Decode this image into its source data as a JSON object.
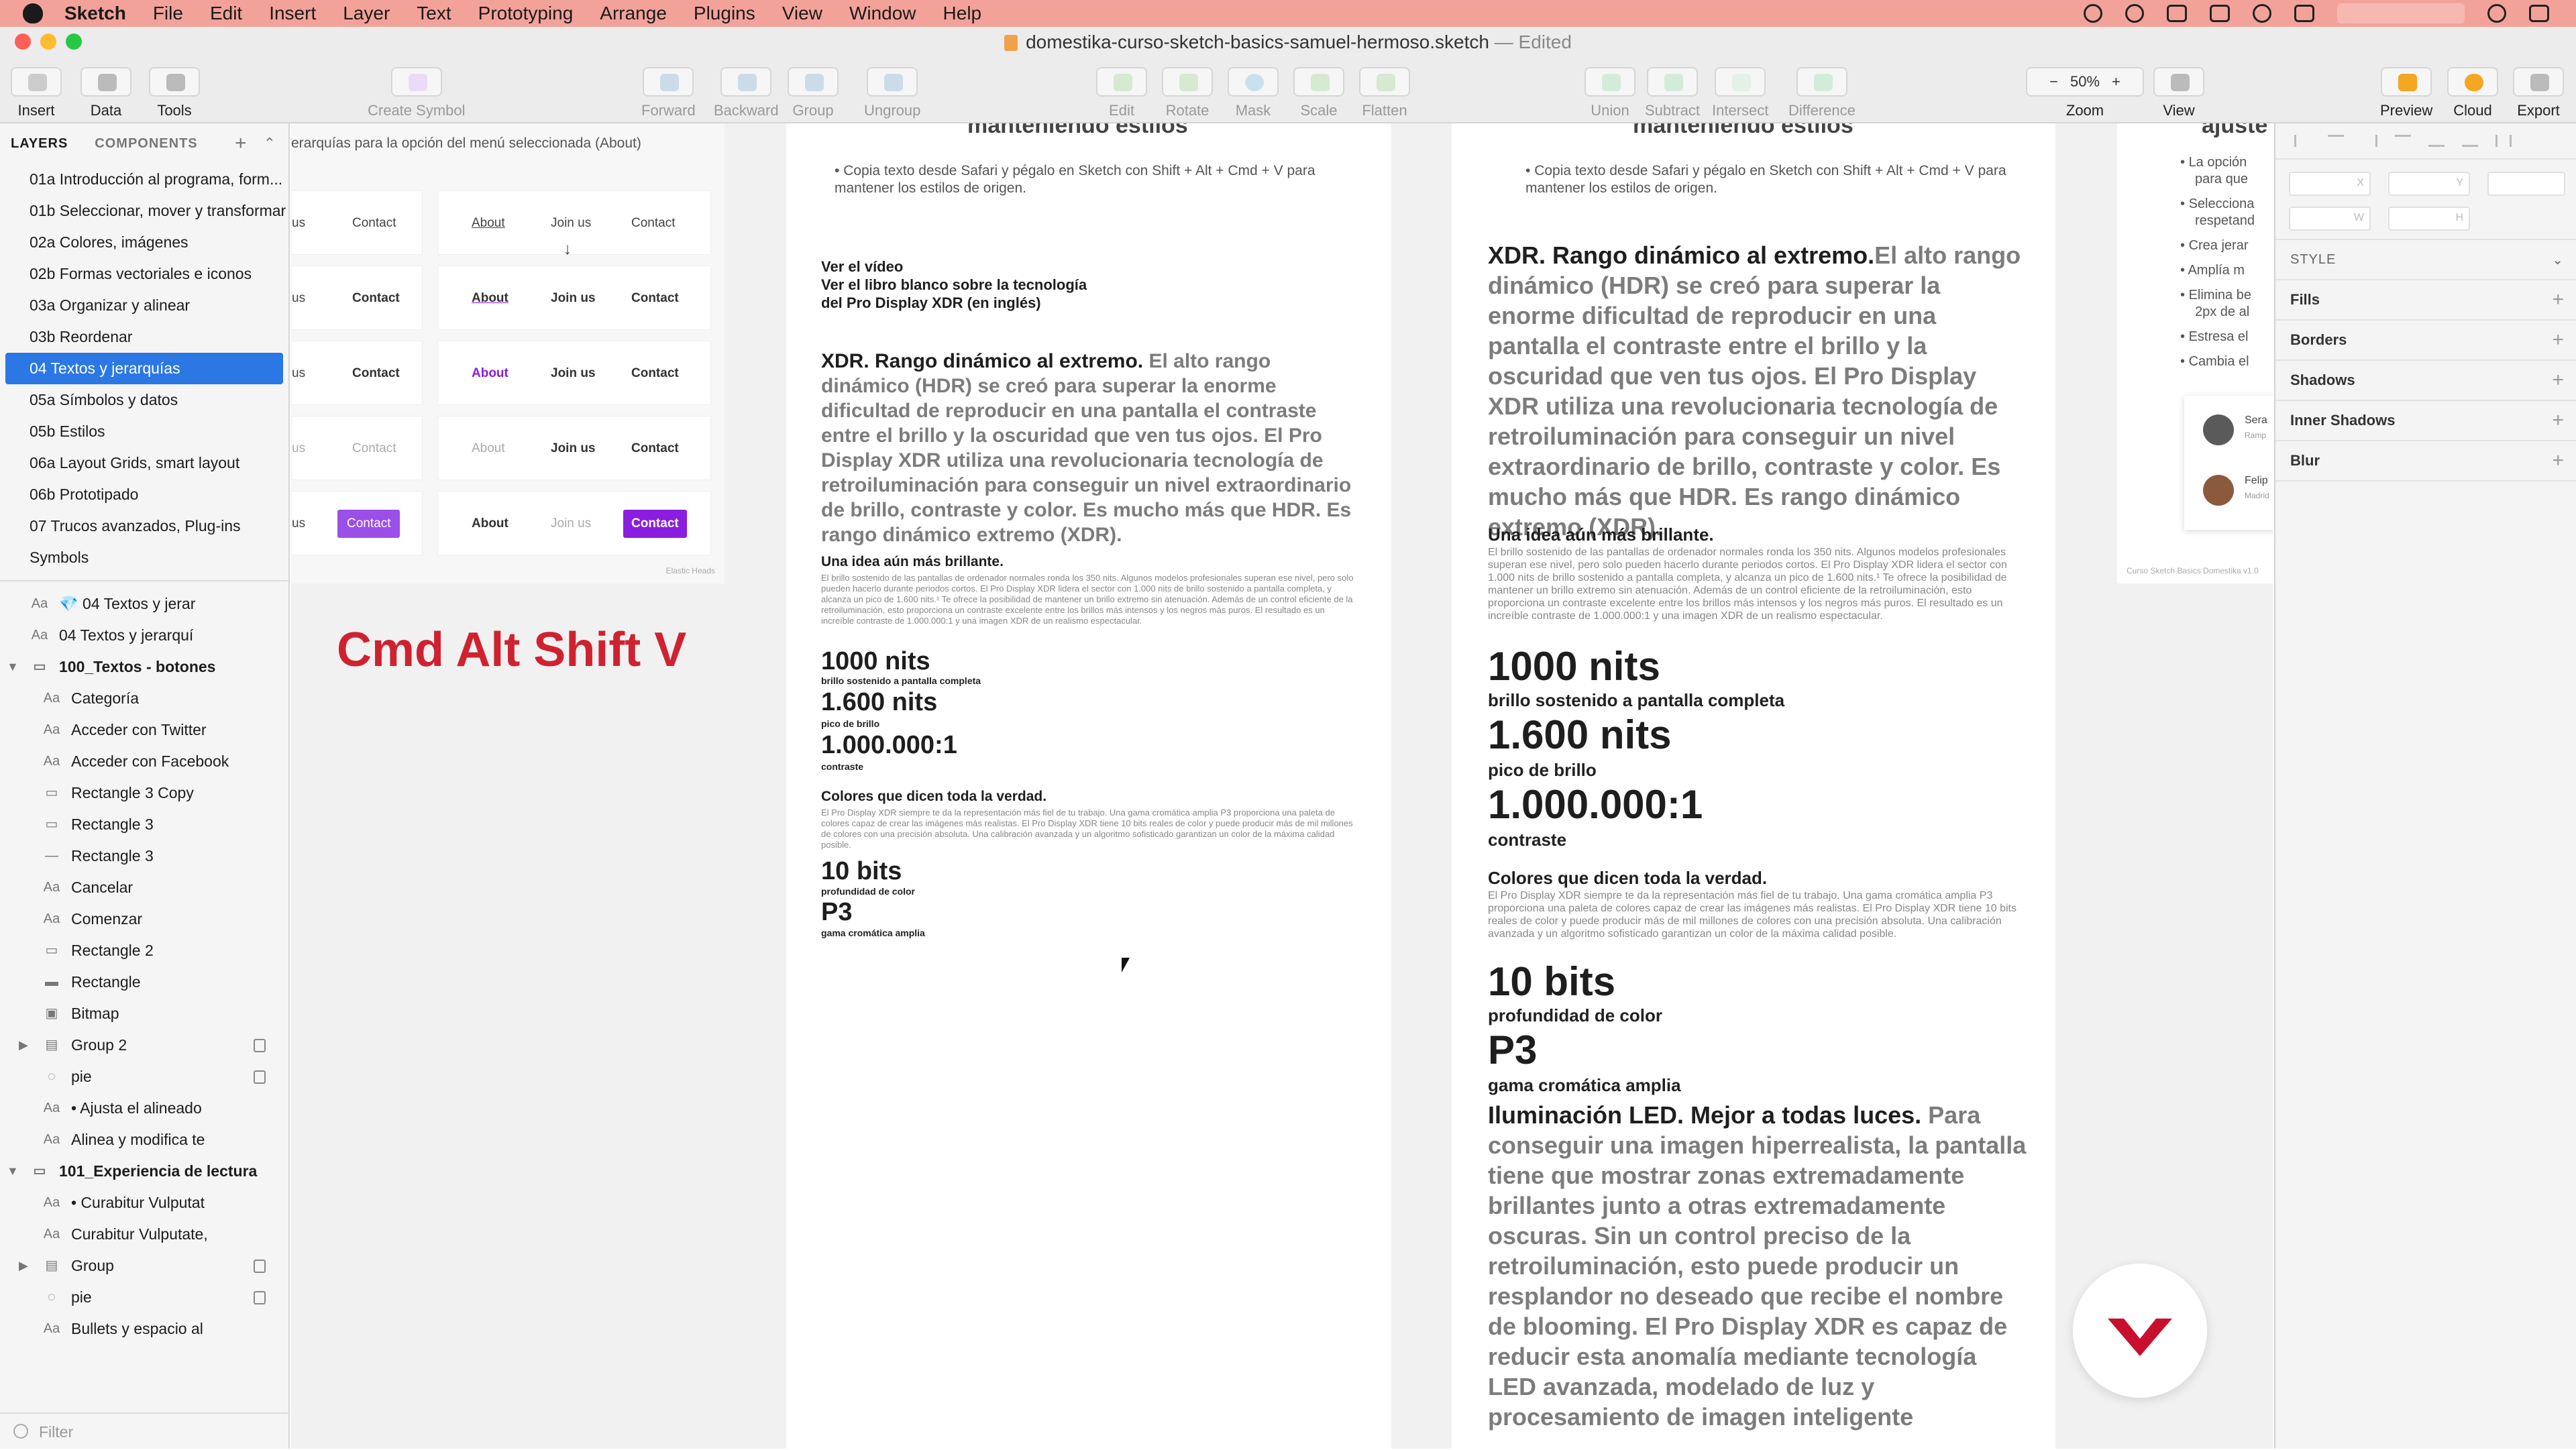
{
  "menubar": {
    "app": "Sketch",
    "items": [
      "File",
      "Edit",
      "Insert",
      "Layer",
      "Text",
      "Prototyping",
      "Arrange",
      "Plugins",
      "View",
      "Window",
      "Help"
    ]
  },
  "window": {
    "file_title": "domestika-curso-sketch-basics-samuel-hermoso.sketch",
    "edited_suffix": "— Edited"
  },
  "toolbar": {
    "insert": "Insert",
    "data": "Data",
    "tools": "Tools",
    "create_symbol": "Create Symbol",
    "forward": "Forward",
    "backward": "Backward",
    "group": "Group",
    "ungroup": "Ungroup",
    "edit": "Edit",
    "rotate": "Rotate",
    "mask": "Mask",
    "scale": "Scale",
    "flatten": "Flatten",
    "union": "Union",
    "subtract": "Subtract",
    "intersect": "Intersect",
    "difference": "Difference",
    "zoom_label": "Zoom",
    "zoom_value": "50%",
    "zoom_minus": "−",
    "zoom_plus": "+",
    "view": "View",
    "preview": "Preview",
    "cloud": "Cloud",
    "export": "Export"
  },
  "sidebar": {
    "tab_layers": "LAYERS",
    "tab_components": "COMPONENTS",
    "pages": [
      "01a Introducción al programa, form...",
      "01b Seleccionar, mover y transformar",
      "02a Colores, imágenes",
      "02b Formas vectoriales e iconos",
      "03a Organizar y alinear",
      "03b Reordenar",
      "04 Textos y jerarquías",
      "05a Símbolos y datos",
      "05b Estilos",
      "06a Layout Grids, smart layout",
      "06b Prototipado",
      "07 Trucos avanzados, Plug-ins",
      "Symbols"
    ],
    "selected_page": 6,
    "top_layers": [
      {
        "icon": "Aa",
        "label": "💎 04 Textos y jerar"
      },
      {
        "icon": "Aa",
        "label": "04 Textos y jerarquí"
      }
    ],
    "group1": {
      "label": "100_Textos - botones",
      "layers": [
        {
          "icon": "Aa",
          "label": "Categoría"
        },
        {
          "icon": "Aa",
          "label": "Acceder con Twitter"
        },
        {
          "icon": "Aa",
          "label": "Acceder con Facebook"
        },
        {
          "icon": "▭",
          "label": "Rectangle 3 Copy"
        },
        {
          "icon": "▭",
          "label": "Rectangle 3"
        },
        {
          "icon": "—",
          "label": "Rectangle 3"
        },
        {
          "icon": "Aa",
          "label": "Cancelar"
        },
        {
          "icon": "Aa",
          "label": "Comenzar"
        },
        {
          "icon": "▭",
          "label": "Rectangle 2"
        },
        {
          "icon": "▬",
          "label": "Rectangle"
        },
        {
          "icon": "▣",
          "label": "Bitmap"
        },
        {
          "icon": "▤",
          "label": "Group 2"
        },
        {
          "icon": "◌",
          "label": "pie"
        },
        {
          "icon": "Aa",
          "label": "• Ajusta el alineado"
        },
        {
          "icon": "Aa",
          "label": "Alinea y modifica te"
        }
      ]
    },
    "group2": {
      "label": "101_Experiencia de lectura",
      "layers": [
        {
          "icon": "Aa",
          "label": "• Curabitur Vulputat"
        },
        {
          "icon": "Aa",
          "label": "Curabitur Vulputate,"
        },
        {
          "icon": "▤",
          "label": "Group"
        },
        {
          "icon": "◌",
          "label": "pie"
        },
        {
          "icon": "Aa",
          "label": "Bullets y espacio al"
        }
      ]
    },
    "filter_placeholder": "Filter"
  },
  "canvas": {
    "nav_caption": "erarquías para la opción del menú seleccionada (About)",
    "nav_rows_left": [
      {
        "a": "us",
        "b": "Contact"
      },
      {
        "a": "us",
        "b": "Contact"
      },
      {
        "a": "us",
        "b": "Contact"
      },
      {
        "a": "us",
        "b": "Contact"
      },
      {
        "a": "us",
        "b": "Contact"
      }
    ],
    "nav_rows_right": [
      {
        "about": "About",
        "join": "Join us",
        "contact": "Contact"
      },
      {
        "about": "About",
        "join": "Join us",
        "contact": "Contact"
      },
      {
        "about": "About",
        "join": "Join us",
        "contact": "Contact"
      },
      {
        "about": "About",
        "join": "Join us",
        "contact": "Contact"
      },
      {
        "about": "About",
        "join": "Join us",
        "contact": "Contact"
      }
    ],
    "arrow": "↓",
    "nav_footer": "Elastic Heads",
    "shortcut": "Cmd Alt Shift V",
    "art_heading": "manteniendo estilos",
    "art_bullet": "Copia texto desde Safari y pégalo en Sketch con Shift + Alt + Cmd + V para mantener los estilos de origen.",
    "links": [
      "Ver el vídeo",
      "Ver el libro blanco sobre la tecnología",
      "del Pro Display XDR (en inglés)"
    ],
    "xdr_title": "XDR. Rango dinámico al extremo.",
    "xdr_body": "El alto rango dinámico (HDR) se creó para superar la enorme dificultad de reproducir en una pantalla el contraste entre el brillo y la oscuridad que ven tus ojos. El Pro Display XDR utiliza una revolucionaria tecnología de retroiluminación para conseguir un nivel extraordinario de brillo, contraste y color. Es mucho más que HDR. Es rango dinámico extremo (XDR).",
    "idea_title": "Una idea aún más brillante.",
    "idea_body": "El brillo sostenido de las pantallas de ordenador normales ronda los 350 nits. Algunos modelos profesionales superan ese nivel, pero solo pueden hacerlo durante periodos cortos. El Pro Display XDR lidera el sector con 1.000 nits de brillo sostenido a pantalla completa, y alcanza un pico de 1.600 nits.¹ Te ofrece la posibilidad de mantener un brillo extremo sin atenuación. Además de un control eficiente de la retroiluminación, esto proporciona un contraste excelente entre los brillos más intensos y los negros más puros. El resultado es un increíble contraste de 1.000.000:1 y una imagen XDR de un realismo espectacular.",
    "stats": [
      {
        "value": "1000 nits",
        "label": "brillo sostenido a pantalla completa"
      },
      {
        "value": "1.600 nits",
        "label": "pico de brillo"
      },
      {
        "value": "1.000.000:1",
        "label": "contraste"
      }
    ],
    "colores_title": "Colores que dicen toda la verdad.",
    "colores_body": "El Pro Display XDR siempre te da la representación más fiel de tu trabajo. Una gama cromática amplia P3 proporciona una paleta de colores capaz de crear las imágenes más realistas. El Pro Display XDR tiene 10 bits reales de color y puede producir más de mil millones de colores con una precisión absoluta. Una calibración avanzada y un algoritmo sofisticado garantizan un color de la máxima calidad posible.",
    "stats2": [
      {
        "value": "10 bits",
        "label": "profundidad de color"
      },
      {
        "value": "P3",
        "label": "gama cromática amplia"
      }
    ],
    "led_title": "Iluminación LED. Mejor a todas luces.",
    "led_body": "Para conseguir una imagen hiperrealista, la pantalla tiene que mostrar zonas extremadamente brillantes junto a otras extremadamente oscuras. Sin un control preciso de la retroiluminación, esto puede producir un resplandor no deseado que recibe el nombre de blooming. El Pro Display XDR es capaz de reducir esta anomalía mediante tecnología LED avanzada, modelado de luz y procesamiento de imagen inteligente",
    "right_heading": "ajuste",
    "right_bullets": [
      "La opción",
      "para que",
      "Selecciona",
      "respetand",
      "Crea jerar",
      "Amplía m",
      "Elimina be",
      "2px de al",
      "Estresa el",
      "Cambia el"
    ],
    "cards": [
      {
        "name": "Sera",
        "sub": "Ramp"
      },
      {
        "name": "Felip",
        "sub": "Madrid"
      }
    ],
    "right_footer": "Curso Sketch Basics Domestika v1.0",
    "colors": {
      "purple": "#8a1de0",
      "violet": "#9a4fe8",
      "shortcut_red": "#cf2230",
      "logo_red": "#c8102e"
    }
  },
  "inspector": {
    "x_label": "X",
    "y_label": "Y",
    "w_label": "W",
    "h_label": "H",
    "style": "STYLE",
    "fills": "Fills",
    "borders": "Borders",
    "shadows": "Shadows",
    "inner_shadows": "Inner Shadows",
    "blur": "Blur",
    "add": "+"
  }
}
